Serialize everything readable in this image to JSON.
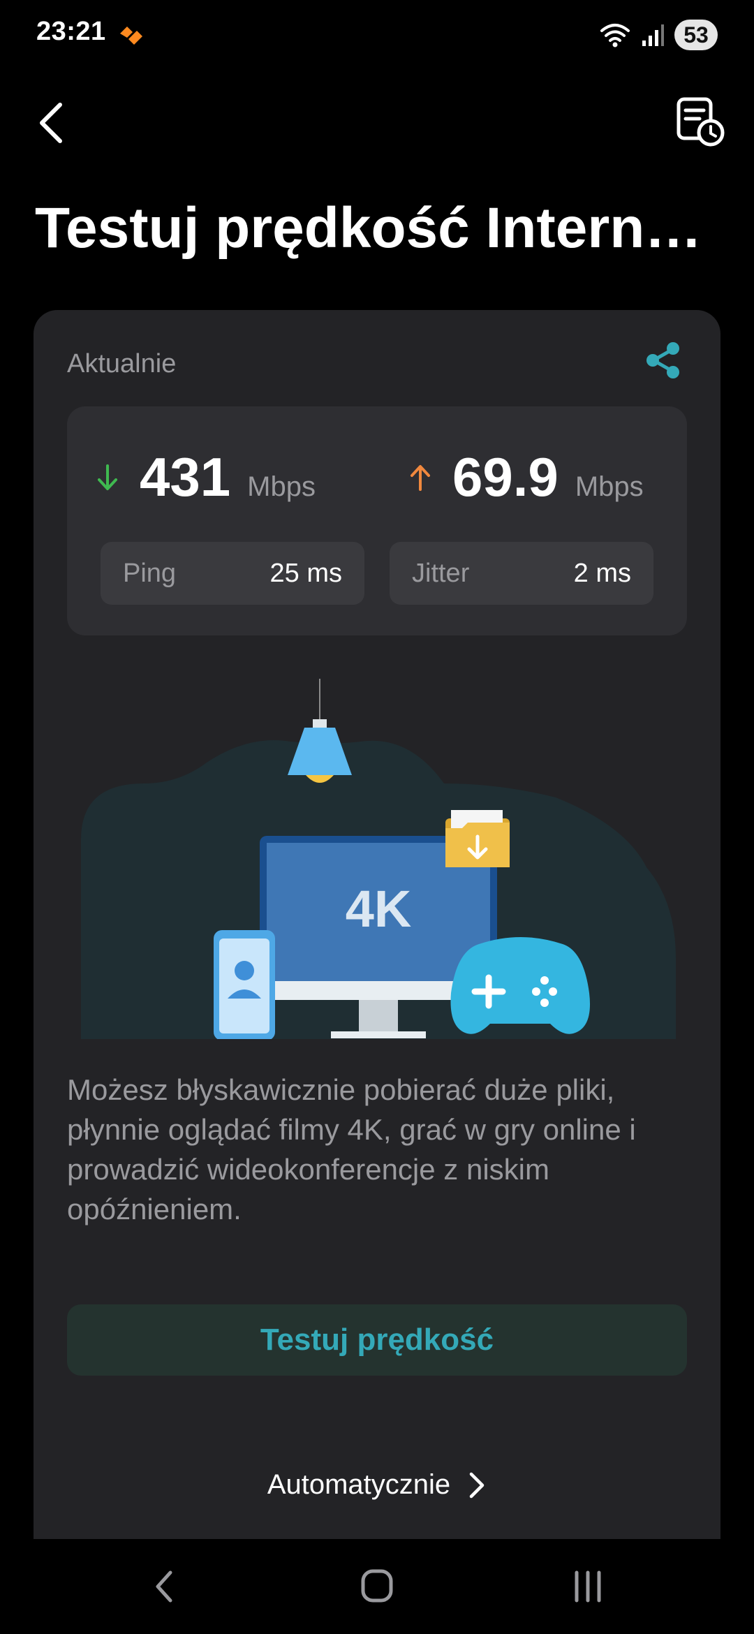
{
  "status_bar": {
    "time": "23:21",
    "battery": "53",
    "icons": [
      "wifi-icon",
      "signal-icon",
      "battery-icon"
    ]
  },
  "header": {
    "title": "Testuj prędkość Internetu",
    "back_icon": "back-arrow-icon",
    "history_icon": "history-log-icon"
  },
  "card": {
    "label": "Aktualnie",
    "share_icon": "share-icon",
    "download": {
      "value": "431",
      "unit": "Mbps",
      "color": "#3fb950"
    },
    "upload": {
      "value": "69.9",
      "unit": "Mbps",
      "color": "#f0883e"
    },
    "ping": {
      "label": "Ping",
      "value": "25 ms"
    },
    "jitter": {
      "label": "Jitter",
      "value": "2 ms"
    },
    "illustration": {
      "screen_text": "4K"
    },
    "description": "Możesz błyskawicznie pobierać duże pliki, płynnie oglądać filmy 4K, grać w gry online i prowadzić wideokonferencje z niskim opóźnieniem.",
    "test_button": "Testuj prędkość",
    "auto_link": "Automatycznie"
  },
  "colors": {
    "accent": "#34a9b8",
    "card_bg": "#232326",
    "page_bg": "#000000"
  }
}
